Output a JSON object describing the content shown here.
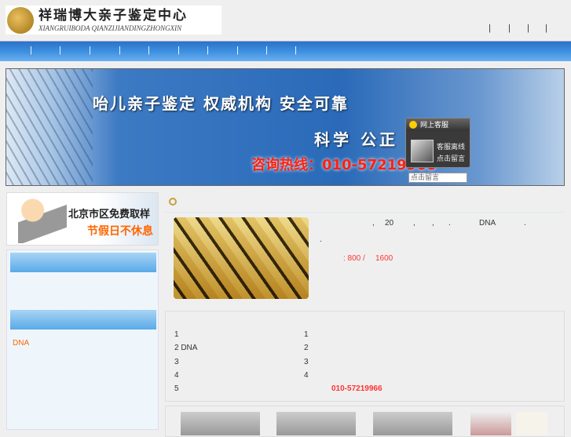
{
  "header": {
    "logo_cn": "祥瑞博大亲子鉴定中心",
    "logo_en": "XIANGRUIBODA QIANZIJIANDINGZHONGXIN",
    "top_seps": [
      "|",
      "|",
      "|",
      "|"
    ]
  },
  "nav": {
    "seps": [
      "|",
      "|",
      "|",
      "|",
      "|",
      "|",
      "|",
      "|",
      "|",
      "|"
    ]
  },
  "banner": {
    "slogan": "咍儿亲子鉴定  权威机构  安全可靠",
    "values": "科学  公正  保密",
    "hotline": "咨询热线：010-57219966"
  },
  "chat": {
    "title": "网上客服",
    "status": "客服离线",
    "action": "点击留言",
    "input_placeholder": "点击留言"
  },
  "sidebar": {
    "ad_line1": "北京市区免费取样",
    "ad_line2": "节假日不休息",
    "dna_link": "DNA"
  },
  "intro": {
    "fragments": [
      ",",
      "20",
      ",",
      ",",
      ".",
      "DNA",
      "."
    ],
    "line2": ".",
    "price_a": ": 800 /",
    "price_b": "1600"
  },
  "list": {
    "left": [
      "1",
      "2 DNA",
      "3",
      "4",
      "5"
    ],
    "right": [
      "1",
      "2",
      "3",
      "4"
    ],
    "phone": "010-57219966"
  }
}
